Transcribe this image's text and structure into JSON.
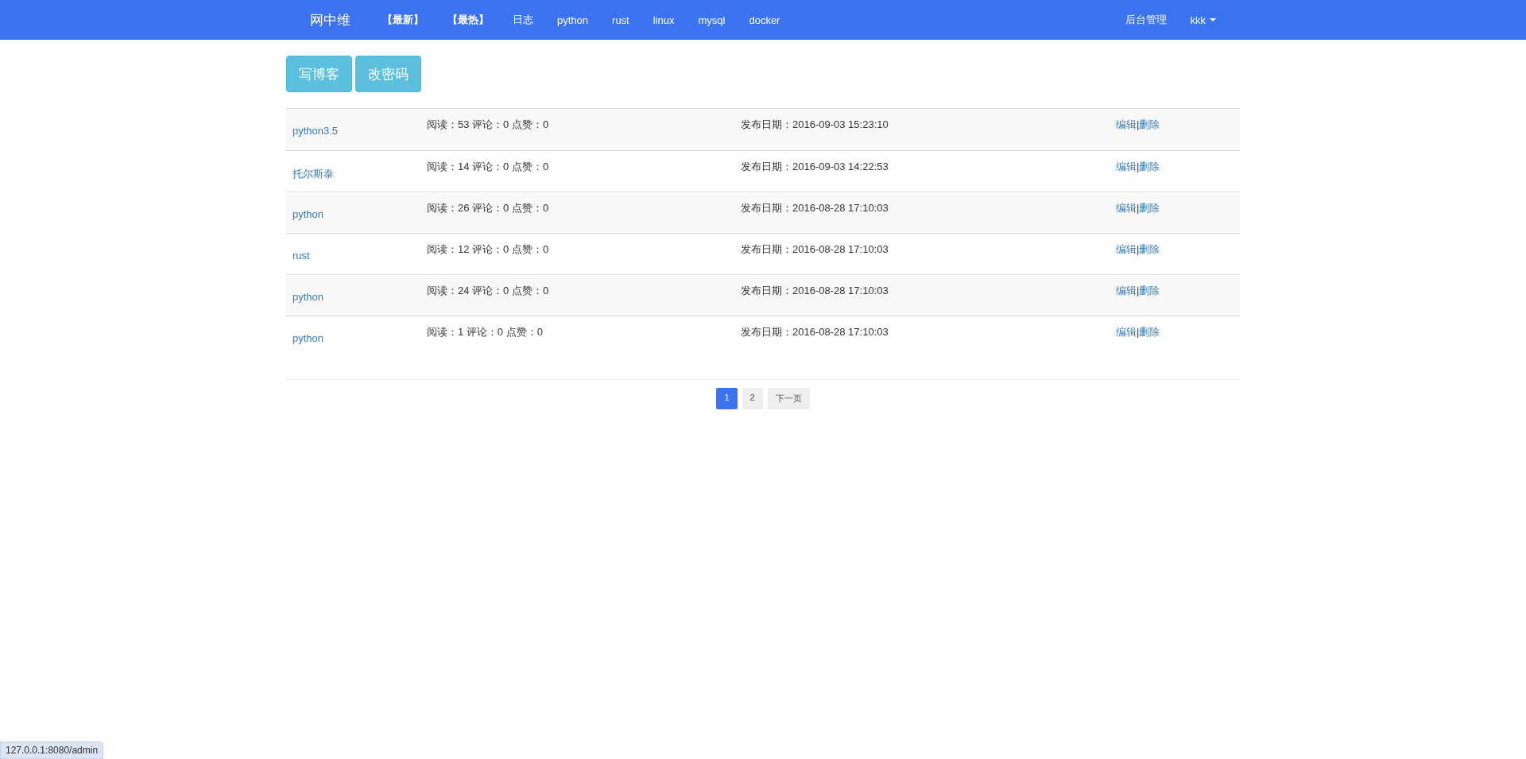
{
  "navbar": {
    "brand": "网中维",
    "links": [
      {
        "label": "【最新】",
        "bold": true
      },
      {
        "label": "【最热】",
        "bold": true
      },
      {
        "label": "日志",
        "bold": false
      },
      {
        "label": "python",
        "bold": false
      },
      {
        "label": "rust",
        "bold": false
      },
      {
        "label": "linux",
        "bold": false
      },
      {
        "label": "mysql",
        "bold": false
      },
      {
        "label": "docker",
        "bold": false
      }
    ],
    "right": {
      "admin": "后台管理",
      "user": "kkk"
    }
  },
  "actions": [
    "写博客",
    "改密码"
  ],
  "posts": [
    {
      "title": "python3.5",
      "stats": "阅读：53 评论：0 点赞：0",
      "date": "发布日期：2016-09-03 15:23:10",
      "edit": "编辑",
      "separator": "|",
      "delete": "删除"
    },
    {
      "title": "托尔斯泰",
      "stats": "阅读：14 评论：0 点赞：0",
      "date": "发布日期：2016-09-03 14:22:53",
      "edit": "编辑",
      "separator": "|",
      "delete": "删除"
    },
    {
      "title": "python",
      "stats": "阅读：26 评论：0 点赞：0",
      "date": "发布日期：2016-08-28 17:10:03",
      "edit": "编辑",
      "separator": "|",
      "delete": "删除"
    },
    {
      "title": "rust",
      "stats": "阅读：12 评论：0 点赞：0",
      "date": "发布日期：2016-08-28 17:10:03",
      "edit": "编辑",
      "separator": "|",
      "delete": "删除"
    },
    {
      "title": "python",
      "stats": "阅读：24 评论：0 点赞：0",
      "date": "发布日期：2016-08-28 17:10:03",
      "edit": "编辑",
      "separator": "|",
      "delete": "删除"
    },
    {
      "title": "python",
      "stats": "阅读：1 评论：0 点赞：0",
      "date": "发布日期：2016-08-28 17:10:03",
      "edit": "编辑",
      "separator": "|",
      "delete": "删除"
    }
  ],
  "pagination": [
    {
      "label": "1",
      "selected": true
    },
    {
      "label": "2",
      "selected": false
    },
    {
      "label": "下一页",
      "selected": false
    }
  ],
  "status_bar": {
    "url": "127.0.0.1:8080/admin"
  }
}
